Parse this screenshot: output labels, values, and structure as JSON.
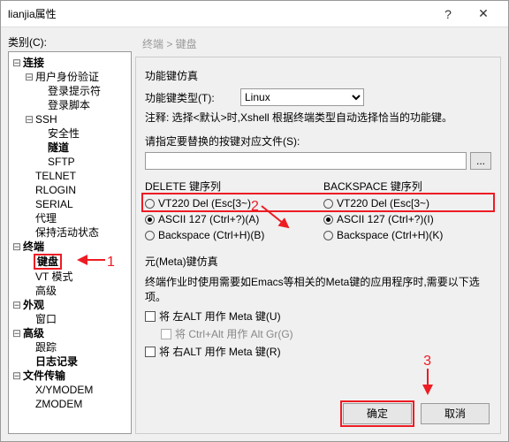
{
  "window": {
    "title": "lianjia属性",
    "help": "?",
    "close": "✕"
  },
  "left_label": "类别(C):",
  "tree": {
    "connection": "连接",
    "auth": "用户身份验证",
    "login_prompt": "登录提示符",
    "login_script": "登录脚本",
    "ssh": "SSH",
    "security": "安全性",
    "tunnel": "隧道",
    "sftp": "SFTP",
    "telnet": "TELNET",
    "rlogin": "RLOGIN",
    "serial": "SERIAL",
    "proxy": "代理",
    "keepalive": "保持活动状态",
    "terminal": "终端",
    "keyboard": "键盘",
    "vtmode": "VT 模式",
    "advanced_t": "高级",
    "appearance": "外观",
    "window": "窗口",
    "advanced": "高级",
    "trace": "跟踪",
    "logging": "日志记录",
    "filetransfer": "文件传输",
    "xymodem": "X/YMODEM",
    "zmodem": "ZMODEM"
  },
  "crumb": "终端 > 键盘",
  "funckey": {
    "title": "功能键仿真",
    "type_label": "功能键类型(T):",
    "type_value": "Linux",
    "note": "注释: 选择<默认>时,Xshell 根据终端类型自动选择恰当的功能键。"
  },
  "swapfile": {
    "label": "请指定要替换的按键对应文件(S):",
    "value": "",
    "browse": "..."
  },
  "delete_seq": {
    "title": "DELETE 键序列",
    "opt1": "VT220 Del (Esc[3~)",
    "opt2": "ASCII 127 (Ctrl+?)(A)",
    "opt3": "Backspace (Ctrl+H)(B)"
  },
  "backspace_seq": {
    "title": "BACKSPACE 键序列",
    "opt1": "VT220 Del (Esc[3~)",
    "opt2": "ASCII 127 (Ctrl+?)(I)",
    "opt3": "Backspace (Ctrl+H)(K)"
  },
  "meta": {
    "title": "元(Meta)键仿真",
    "note": "终端作业时使用需要如Emacs等相关的Meta键的应用程序时,需要以下选项。",
    "left_alt": "将 左ALT 用作 Meta 键(U)",
    "ctrl_alt": "将 Ctrl+Alt 用作 Alt Gr(G)",
    "right_alt": "将 右ALT 用作 Meta 键(R)"
  },
  "buttons": {
    "ok": "确定",
    "cancel": "取消"
  },
  "annot": {
    "a1": "1",
    "a2": "2",
    "a3": "3"
  }
}
